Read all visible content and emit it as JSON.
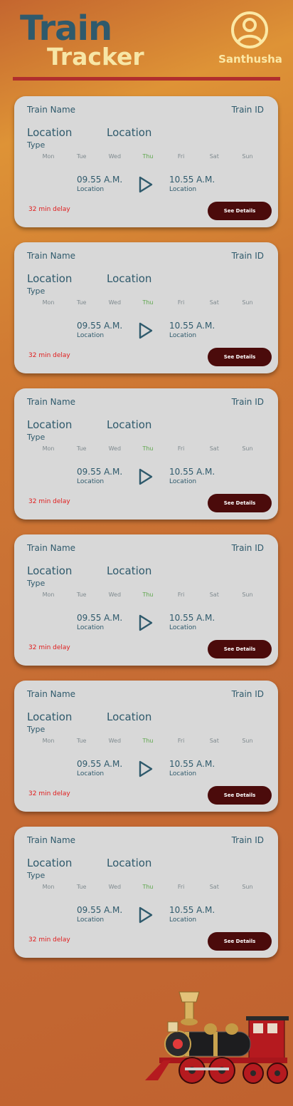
{
  "header": {
    "title_line1": "Train",
    "title_line2": "Tracker",
    "username": "Santhusha"
  },
  "colors": {
    "title_dark": "#2f5a6c",
    "title_light": "#f7e6a6",
    "divider": "#b02e2d",
    "card_bg": "#d8d8d8",
    "button_bg": "#4b0b0b",
    "delay_text": "#e01e1e",
    "active_day": "#5ca64a"
  },
  "cards": [
    {
      "train_name": "Train Name",
      "train_id": "Train ID",
      "location_from": "Location",
      "location_to": "Location",
      "type": "Type",
      "days": [
        "Mon",
        "Tue",
        "Wed",
        "Thu",
        "Fri",
        "Sat",
        "Sun"
      ],
      "active_day": "Thu",
      "departure_time": "09.55 A.M.",
      "departure_location": "Location",
      "arrival_time": "10.55 A.M.",
      "arrival_location": "Location",
      "delay": "32 min delay",
      "button": "See Details"
    },
    {
      "train_name": "Train Name",
      "train_id": "Train ID",
      "location_from": "Location",
      "location_to": "Location",
      "type": "Type",
      "days": [
        "Mon",
        "Tue",
        "Wed",
        "Thu",
        "Fri",
        "Sat",
        "Sun"
      ],
      "active_day": "Thu",
      "departure_time": "09.55 A.M.",
      "departure_location": "Location",
      "arrival_time": "10.55 A.M.",
      "arrival_location": "Location",
      "delay": "32 min delay",
      "button": "See Details"
    },
    {
      "train_name": "Train Name",
      "train_id": "Train ID",
      "location_from": "Location",
      "location_to": "Location",
      "type": "Type",
      "days": [
        "Mon",
        "Tue",
        "Wed",
        "Thu",
        "Fri",
        "Sat",
        "Sun"
      ],
      "active_day": "Thu",
      "departure_time": "09.55 A.M.",
      "departure_location": "Location",
      "arrival_time": "10.55 A.M.",
      "arrival_location": "Location",
      "delay": "32 min delay",
      "button": "See Details"
    },
    {
      "train_name": "Train Name",
      "train_id": "Train ID",
      "location_from": "Location",
      "location_to": "Location",
      "type": "Type",
      "days": [
        "Mon",
        "Tue",
        "Wed",
        "Thu",
        "Fri",
        "Sat",
        "Sun"
      ],
      "active_day": "Thu",
      "departure_time": "09.55 A.M.",
      "departure_location": "Location",
      "arrival_time": "10.55 A.M.",
      "arrival_location": "Location",
      "delay": "32 min delay",
      "button": "See Details"
    },
    {
      "train_name": "Train Name",
      "train_id": "Train ID",
      "location_from": "Location",
      "location_to": "Location",
      "type": "Type",
      "days": [
        "Mon",
        "Tue",
        "Wed",
        "Thu",
        "Fri",
        "Sat",
        "Sun"
      ],
      "active_day": "Thu",
      "departure_time": "09.55 A.M.",
      "departure_location": "Location",
      "arrival_time": "10.55 A.M.",
      "arrival_location": "Location",
      "delay": "32 min delay",
      "button": "See Details"
    },
    {
      "train_name": "Train Name",
      "train_id": "Train ID",
      "location_from": "Location",
      "location_to": "Location",
      "type": "Type",
      "days": [
        "Mon",
        "Tue",
        "Wed",
        "Thu",
        "Fri",
        "Sat",
        "Sun"
      ],
      "active_day": "Thu",
      "departure_time": "09.55 A.M.",
      "departure_location": "Location",
      "arrival_time": "10.55 A.M.",
      "arrival_location": "Location",
      "delay": "32 min delay",
      "button": "See Details"
    }
  ],
  "icons": {
    "profile": "user-circle-icon",
    "journey": "play-arrow-icon",
    "illustration": "steam-locomotive"
  }
}
